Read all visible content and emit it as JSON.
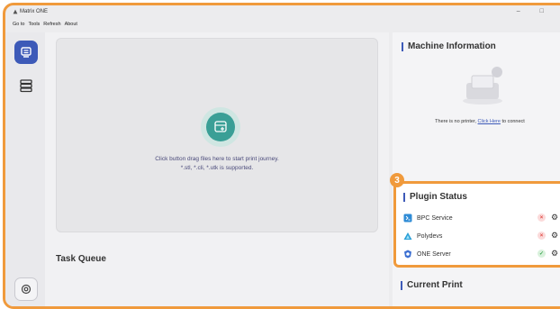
{
  "app": {
    "title": "Matrix ONE"
  },
  "window_controls": {
    "minimize": "–",
    "maximize": "□",
    "close": "×"
  },
  "menu": [
    "Go to",
    "Tools",
    "Refresh",
    "About"
  ],
  "dropzone": {
    "line1": "Click button drag files here to start print journey.",
    "line2": "*.stl, *.cli, *.utk is supported."
  },
  "task_queue": {
    "title": "Task Queue"
  },
  "machine_info": {
    "title": "Machine Information",
    "plus": "+",
    "empty_text": "There is no printer,",
    "link": "Click Here",
    "suffix": "to connect"
  },
  "step_badge": "3",
  "plugin_status": {
    "title": "Plugin Status",
    "items": [
      {
        "name": "BPC Service",
        "status": "error"
      },
      {
        "name": "Polydevs",
        "status": "error"
      },
      {
        "name": "ONE Server",
        "status": "ok"
      }
    ]
  },
  "current_print": {
    "title": "Current Print"
  },
  "colors": {
    "accent": "#3d5ab8",
    "highlight": "#f09a3c",
    "teal": "#3a9f96"
  },
  "icons": [
    "logo-icon",
    "printer-icon",
    "list-icon",
    "settings-icon",
    "upload-icon",
    "gear-icon"
  ]
}
